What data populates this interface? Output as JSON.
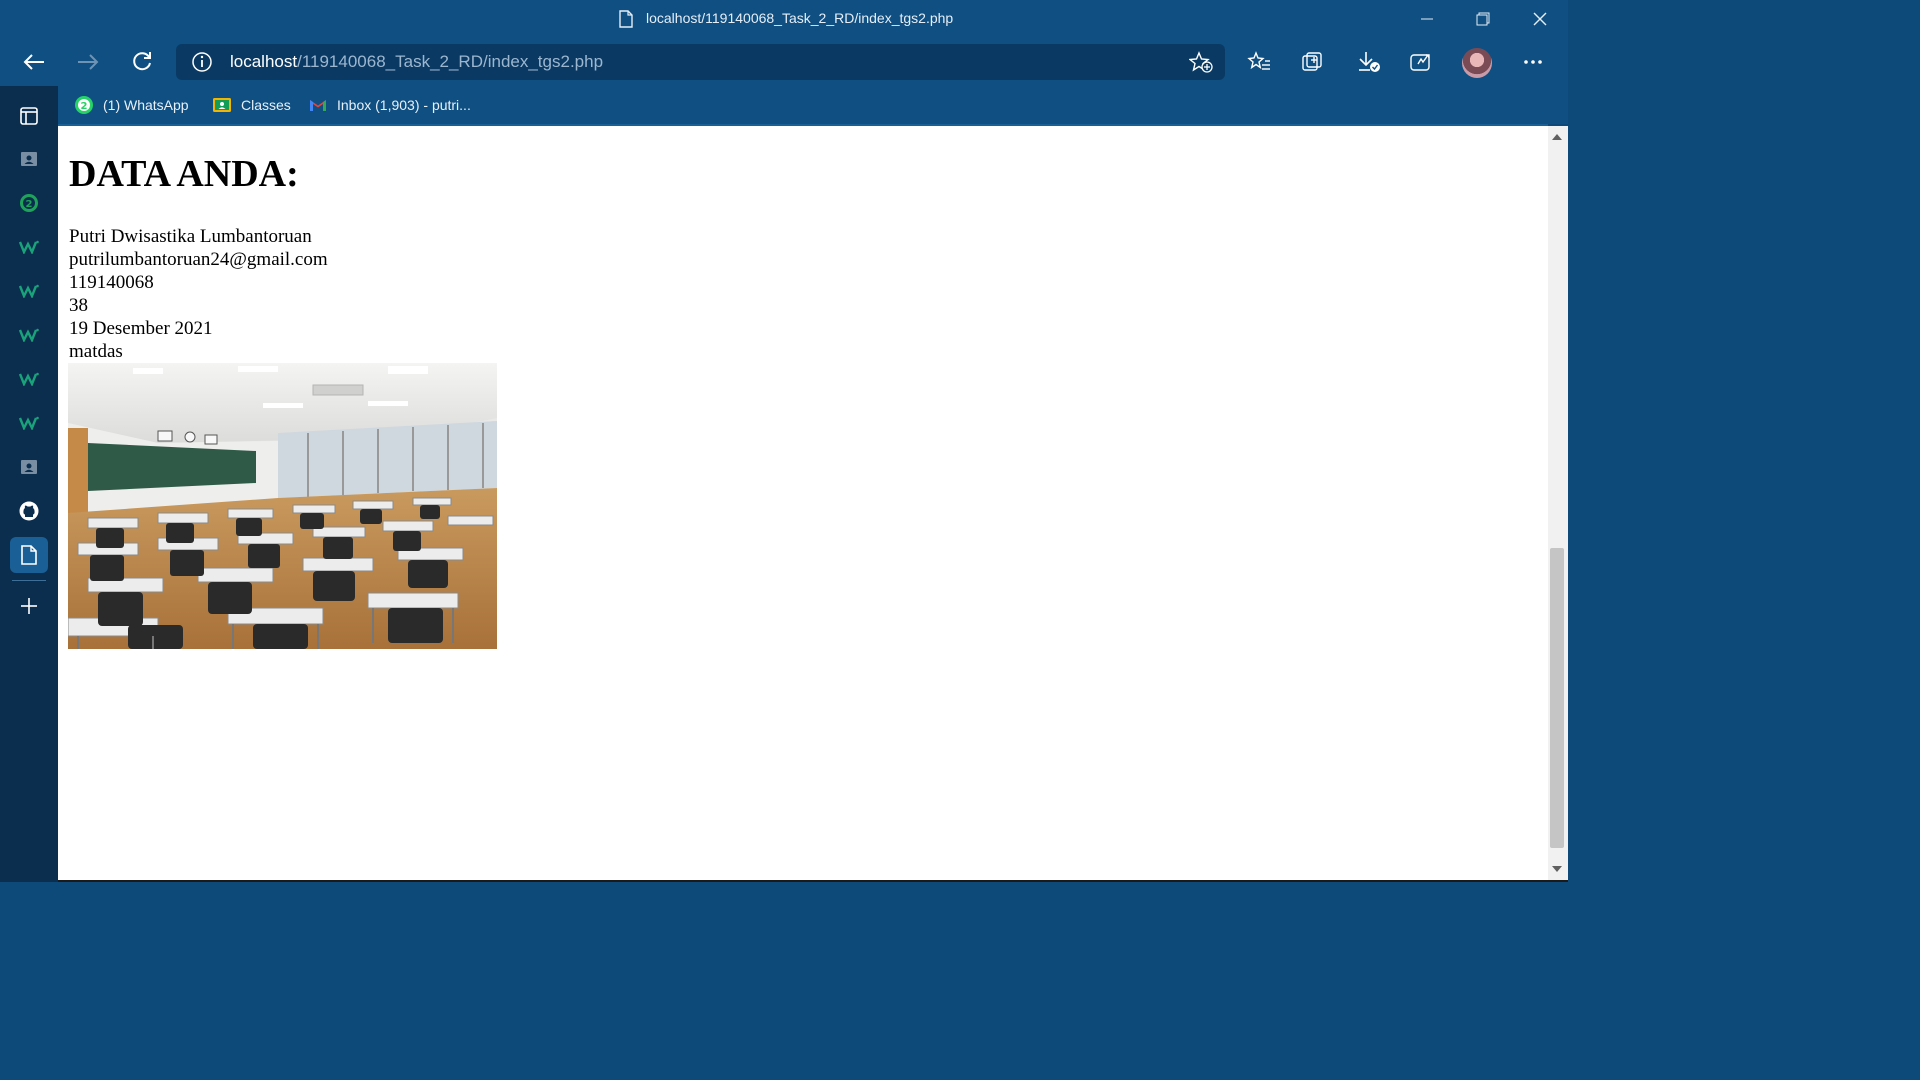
{
  "window": {
    "title": "localhost/119140068_Task_2_RD/index_tgs2.php"
  },
  "address_bar": {
    "host": "localhost",
    "path": "/119140068_Task_2_RD/index_tgs2.php"
  },
  "bookmarks": [
    {
      "label": "(1) WhatsApp",
      "icon": "whatsapp-icon"
    },
    {
      "label": "Classes",
      "icon": "google-classroom-icon"
    },
    {
      "label": "Inbox (1,903) - putri...",
      "icon": "gmail-icon"
    }
  ],
  "sidebar": {
    "whatsapp_badge": "2"
  },
  "page": {
    "heading": "DATA ANDA:",
    "name": "Putri Dwisastika Lumbantoruan",
    "email": "putrilumbantoruan24@gmail.com",
    "nim": "119140068",
    "number": "38",
    "date": "19 Desember 2021",
    "course": "matdas"
  },
  "colors": {
    "chrome": "#0f4f82",
    "sidebar": "#0b2e4f",
    "address": "#0a3a63"
  }
}
